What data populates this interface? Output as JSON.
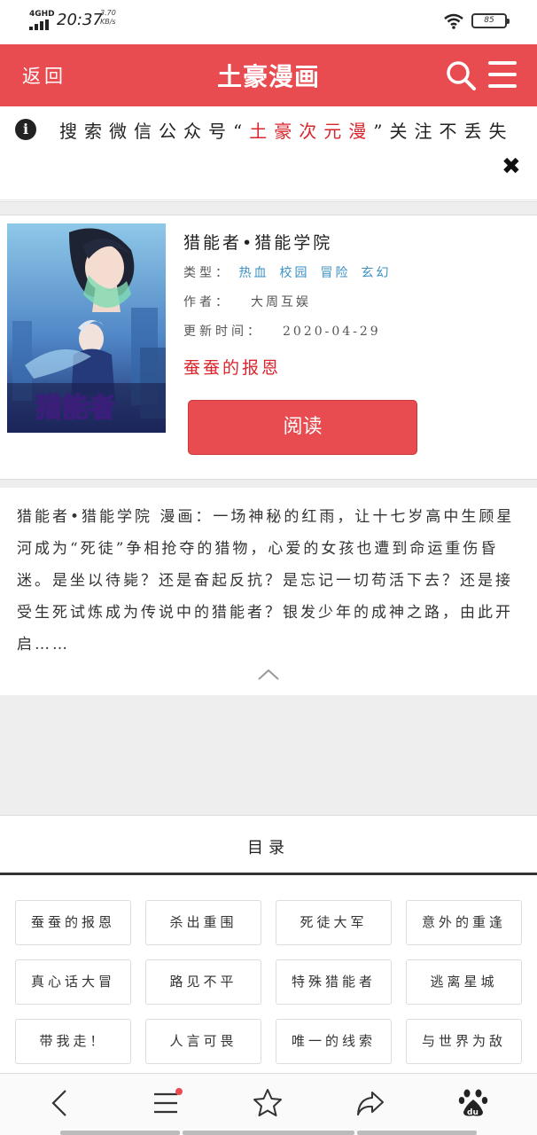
{
  "status_bar": {
    "network": "4GHD",
    "time": "20:37",
    "speed": "3.70",
    "speed_unit": "KB/s",
    "battery": "85"
  },
  "header": {
    "back_label": "返回",
    "brand": "土豪漫画",
    "search_icon": "search-icon",
    "menu_icon": "menu-icon"
  },
  "notice": {
    "prefix": "搜索微信公众号“",
    "highlight": "土豪次元漫",
    "suffix": "”关注不丢失",
    "close": "✖"
  },
  "comic": {
    "title": "猎能者•猎能学院",
    "type_label": "类型：",
    "tags": [
      "热血",
      "校园",
      "冒险",
      "玄幻"
    ],
    "author_label": "作者：",
    "author": "大周互娱",
    "updated_label": "更新时间：",
    "updated": "2020-04-29",
    "latest_chapter": "蚕蚕的报恩",
    "read_button": "阅读",
    "cover_text": "猎能者"
  },
  "synopsis": {
    "text": "猎能者•猎能学院 漫画：一场神秘的红雨，让十七岁高中生顾星河成为“死徒”争相抢夺的猎物，心爱的女孩也遭到命运重伤昏迷。是坐以待毙？还是奋起反抗？是忘记一切苟活下去？还是接受生死试炼成为传说中的猎能者？银发少年的成神之路，由此开启……"
  },
  "toc": {
    "title": "目录",
    "chapters": [
      "蚕蚕的报恩",
      "杀出重围",
      "死徒大军",
      "意外的重逢",
      "真心话大冒",
      "路见不平",
      "特殊猎能者",
      "逃离星城",
      "带我走！",
      "人言可畏",
      "唯一的线索",
      "与世界为敌"
    ]
  },
  "bottom_nav": {
    "icons": [
      "back-icon",
      "tabs-icon",
      "star-icon",
      "share-icon",
      "baidu-icon"
    ]
  },
  "colors": {
    "brand_red": "#e84b50",
    "tag_blue": "#3a8fc5",
    "highlight_red": "#d8262c"
  }
}
